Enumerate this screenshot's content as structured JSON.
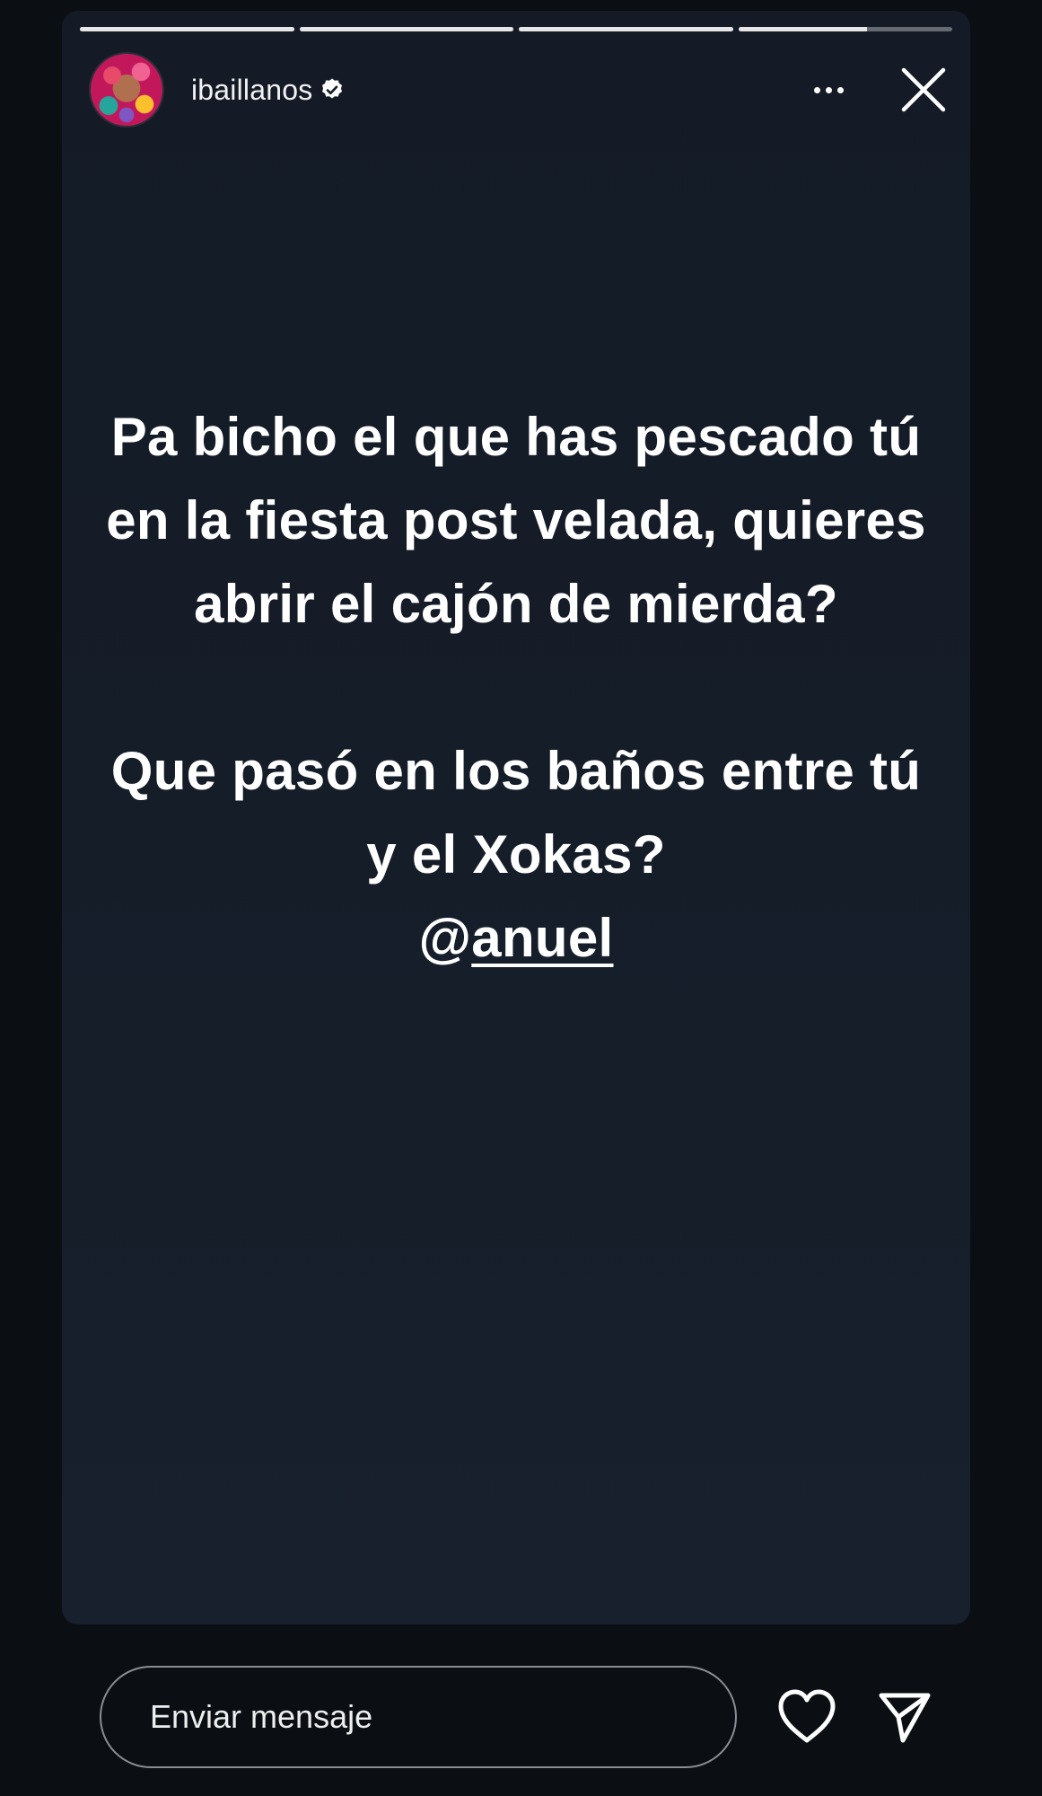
{
  "story": {
    "progress": [
      1,
      1,
      1,
      0.6
    ],
    "author": {
      "username": "ibaillanos",
      "verified": true,
      "avatar_icon": "avatar-icon"
    },
    "actions": {
      "more_icon": "more-horizontal-icon",
      "close_icon": "close-icon"
    },
    "text": {
      "paragraph1": "Pa bicho el que has pescado tú en la fiesta post velada, quieres abrir el cajón de mierda?",
      "paragraph2": "Que pasó en los baños entre tú y el Xokas?",
      "mention_at": "@",
      "mention_name": "anuel"
    }
  },
  "reply_bar": {
    "placeholder": "Enviar mensaje",
    "like_icon": "heart-icon",
    "send_icon": "send-icon"
  },
  "colors": {
    "background": "#0b0f14",
    "card": "#151d29",
    "text": "#ffffff",
    "input_border": "#8a8d93"
  }
}
